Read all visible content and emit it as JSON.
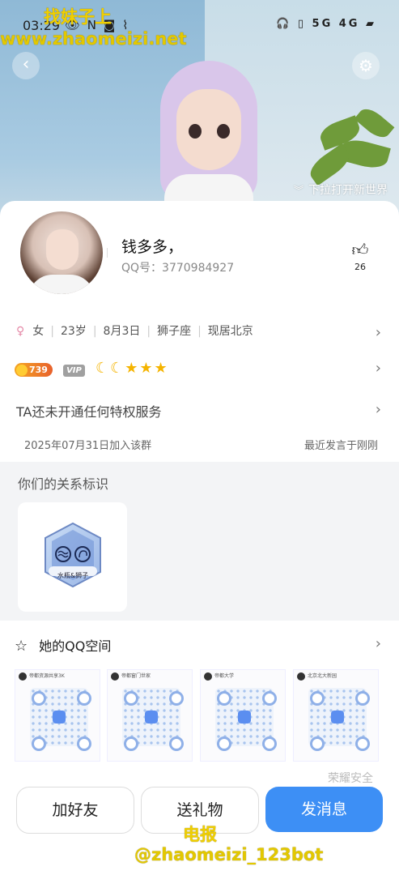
{
  "statusbar": {
    "time": "03:29",
    "left_icons": "👁 N ◙ ⌇",
    "right_icons": "🎧 ▯ 5G 4G ▰"
  },
  "header": {
    "pull_hint": "下拉打开新世界"
  },
  "watermarks": {
    "wm1": "找妹子上",
    "wm2": "www.zhaomeizi.net",
    "wm3": "电报",
    "wm4": "@zhaomeizi_123bot"
  },
  "profile": {
    "nickname": "钱多多，",
    "qq_label": "QQ号：3770984927",
    "likes": "26",
    "gender": "女",
    "age": "23岁",
    "birthday": "8月3日",
    "zodiac": "狮子座",
    "location": "现居北京",
    "level": "739",
    "vip": "VIP",
    "privilege": "TA还未开通任何特权服务",
    "joined": "2025年07月31日加入该群",
    "last_speak": "最近发言于刚刚"
  },
  "relationship": {
    "title": "你们的关系标识",
    "badge_label": "水瓶&狮子"
  },
  "qzone": {
    "title": "她的QQ空间",
    "thumbs": [
      {
        "head": "帝都资源共享3K"
      },
      {
        "head": "帝都窗门世家"
      },
      {
        "head": "帝都大学"
      },
      {
        "head": "北京北大新园"
      }
    ]
  },
  "footer": {
    "honor": "荣耀安全"
  },
  "actions": {
    "add_friend": "加好友",
    "send_gift": "送礼物",
    "send_msg": "发消息"
  }
}
